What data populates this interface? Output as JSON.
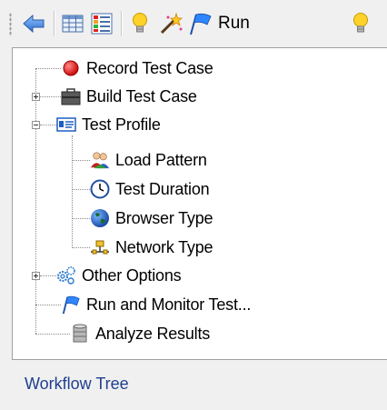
{
  "toolbar": {
    "run_label": "Run"
  },
  "tree": {
    "items": [
      {
        "label": "Record Test Case",
        "icon": "record-icon"
      },
      {
        "label": "Build Test Case",
        "icon": "briefcase-icon"
      },
      {
        "label": "Test Profile",
        "icon": "profile-card-icon"
      },
      {
        "label": "Load Pattern",
        "icon": "users-icon"
      },
      {
        "label": "Test Duration",
        "icon": "clock-icon"
      },
      {
        "label": "Browser Type",
        "icon": "globe-icon"
      },
      {
        "label": "Network Type",
        "icon": "network-icon"
      },
      {
        "label": "Other Options",
        "icon": "gears-icon"
      },
      {
        "label": "Run and Monitor Test...",
        "icon": "flag-icon"
      },
      {
        "label": "Analyze Results",
        "icon": "database-icon"
      }
    ]
  },
  "footer": {
    "label": "Workflow Tree"
  }
}
